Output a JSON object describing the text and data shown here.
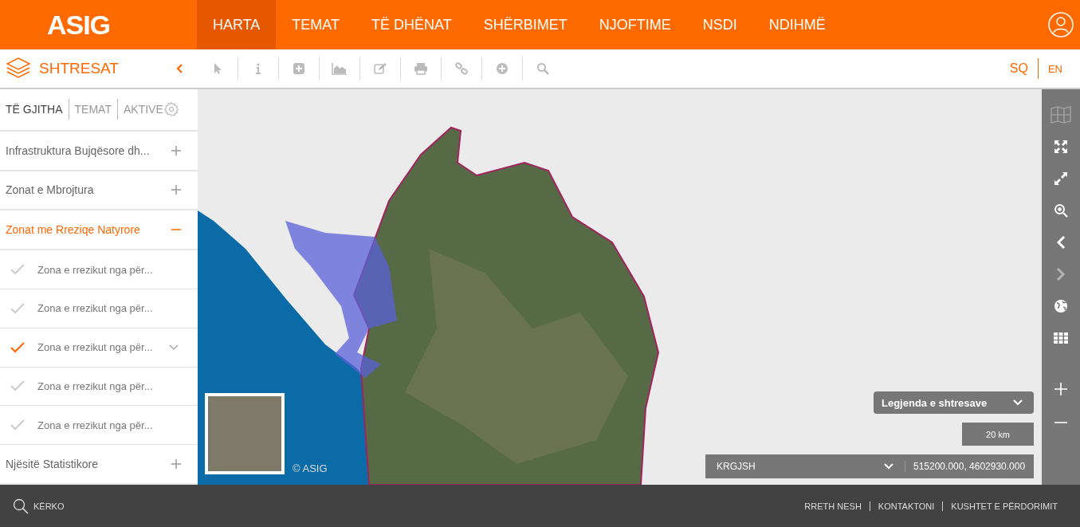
{
  "header": {
    "logo": "ASIG",
    "nav": [
      {
        "label": "HARTA",
        "selected": true
      },
      {
        "label": "TEMAT",
        "selected": false
      },
      {
        "label": "TË DHËNAT",
        "selected": false
      },
      {
        "label": "SHËRBIMET",
        "selected": false
      },
      {
        "label": "NJOFTIME",
        "selected": false
      },
      {
        "label": "NSDI",
        "selected": false
      },
      {
        "label": "NDIHMË",
        "selected": false
      }
    ]
  },
  "toolbar": {
    "title": "SHTRESAT",
    "tools": [
      {
        "kind": "pointer"
      },
      {
        "kind": "info"
      },
      {
        "kind": "add"
      },
      {
        "kind": "chart"
      },
      {
        "kind": "edit"
      },
      {
        "kind": "print"
      },
      {
        "kind": "link"
      },
      {
        "kind": "plus"
      },
      {
        "kind": "search"
      }
    ],
    "languages": [
      {
        "label": "SQ",
        "selected": true
      },
      {
        "label": "EN",
        "selected": false
      }
    ]
  },
  "sidebar": {
    "tabs": [
      {
        "label": "TË GJITHA",
        "selected": true
      },
      {
        "label": "TEMAT",
        "selected": false
      },
      {
        "label": "AKTIVE",
        "selected": false
      }
    ],
    "groups": [
      {
        "label": "Infrastruktura Bujqësore dh...",
        "expanded": false
      },
      {
        "label": "Zonat e Mbrojtura",
        "expanded": false
      },
      {
        "label": "Zonat me Rreziqe Natyrore",
        "expanded": true,
        "children": [
          {
            "label": "Zona e rrezikut nga për...",
            "checked": false
          },
          {
            "label": "Zona e rrezikut nga për...",
            "checked": false
          },
          {
            "label": "Zona e rrezikut nga për...",
            "checked": true
          },
          {
            "label": "Zona e rrezikut nga për...",
            "checked": false
          },
          {
            "label": "Zona e rrezikut nga për...",
            "checked": false
          }
        ]
      },
      {
        "label": "Njësitë Statistikore",
        "expanded": false
      }
    ]
  },
  "map": {
    "attribution": "© ASIG",
    "legend": "Legjenda e shtresave",
    "scale": "20 km",
    "projection": "KRGJSH",
    "coordinates": "515200.000, 4602930.000",
    "tools": [
      {
        "kind": "basemap",
        "disabled": false
      },
      {
        "kind": "full-extent",
        "disabled": false
      },
      {
        "kind": "fullscreen",
        "disabled": false
      },
      {
        "kind": "zoom-box",
        "disabled": false
      },
      {
        "kind": "back",
        "disabled": false
      },
      {
        "kind": "forward",
        "disabled": true
      },
      {
        "kind": "globe",
        "disabled": false
      },
      {
        "kind": "grid",
        "disabled": false
      }
    ]
  },
  "footer": {
    "search": "KËRKO",
    "links": [
      "RRETH NESH",
      "KONTAKTONI",
      "KUSHTET E PËRDORIMIT"
    ]
  }
}
